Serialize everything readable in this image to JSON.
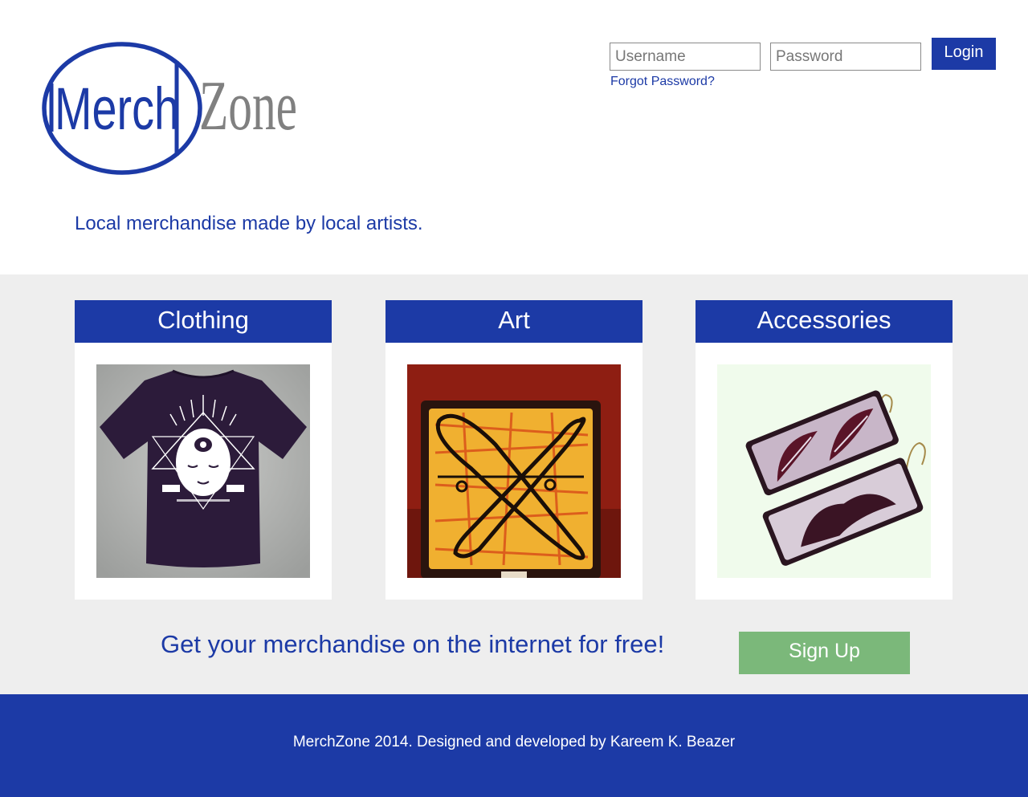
{
  "brand": {
    "logo_part1": "Merch",
    "logo_part2": "Zone",
    "colors": {
      "primary": "#1c3aa6",
      "logo_gray": "#808080",
      "signup_green": "#7bb87a",
      "band_bg": "#eeeeee"
    }
  },
  "header": {
    "tagline": "Local merchandise made by local artists."
  },
  "login": {
    "username_placeholder": "Username",
    "password_placeholder": "Password",
    "button_label": "Login",
    "forgot_label": "Forgot Password?"
  },
  "categories": [
    {
      "title": "Clothing",
      "image": "t-shirt-photo"
    },
    {
      "title": "Art",
      "image": "painting-photo"
    },
    {
      "title": "Accessories",
      "image": "earrings-photo"
    }
  ],
  "promo": {
    "text": "Get your merchandise on the internet for free!",
    "signup_label": "Sign Up"
  },
  "footer": {
    "text": "MerchZone 2014. Designed and developed by Kareem K. Beazer"
  }
}
